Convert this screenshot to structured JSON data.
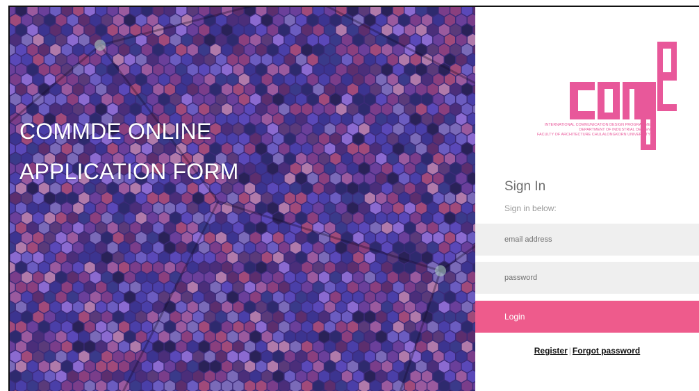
{
  "hero": {
    "title_line1": "COMMDE ONLINE",
    "title_line2": "APPLICATION FORM"
  },
  "logo": {
    "wordmark": "comde",
    "line1": "INTERNATIONAL COMMUNICATION DESIGN PROGRAMME",
    "line2": "DEPARTMENT OF INDUSTRIAL DESIGN",
    "line3": "FACULTY OF ARCHITECTURE CHULALONGKORN UNIVERSITY",
    "color": "#e8589a"
  },
  "signin": {
    "title": "Sign In",
    "subtitle": "Sign in below:",
    "email_placeholder": "email address",
    "password_placeholder": "password",
    "login_label": "Login",
    "register_label": "Register",
    "separator": "|",
    "forgot_label": "Forgot password"
  },
  "colors": {
    "accent": "#ee5b8c",
    "input_bg": "#efefef",
    "hero_base": "#3b2a78"
  }
}
